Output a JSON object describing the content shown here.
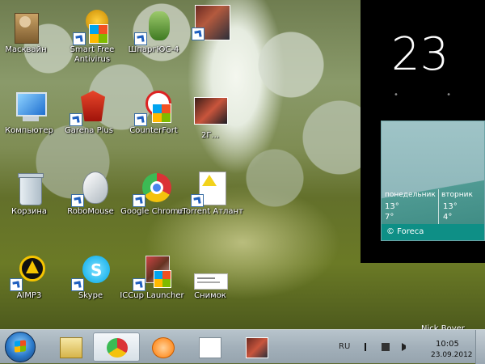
{
  "desktop": {
    "icons": [
      {
        "id": "mas",
        "label": "Масквайн"
      },
      {
        "id": "smart",
        "label": "Smart Free Antivirus"
      },
      {
        "id": "shpar",
        "label": "ШпаргЮС-4"
      },
      {
        "id": "top4",
        "label": ""
      },
      {
        "id": "comp",
        "label": "Компьютер"
      },
      {
        "id": "garena",
        "label": "Garena Plus"
      },
      {
        "id": "counter",
        "label": "CounterFort"
      },
      {
        "id": "mid4",
        "label": "2Г..."
      },
      {
        "id": "trash",
        "label": "Корзина"
      },
      {
        "id": "robo",
        "label": "RoboMouse"
      },
      {
        "id": "chrome",
        "label": "Google Chrome"
      },
      {
        "id": "utorrent",
        "label": "uTorrent Атлант"
      },
      {
        "id": "aimp",
        "label": "AIMP3"
      },
      {
        "id": "skype",
        "label": "Skype"
      },
      {
        "id": "iccup",
        "label": "ICCup Launcher"
      },
      {
        "id": "snimok",
        "label": "Снимок"
      }
    ],
    "username": "Nick Boyer"
  },
  "tiles": {
    "date_number": "23",
    "weather": {
      "days": [
        {
          "name": "понедельник",
          "high": "13°",
          "low": "7°"
        },
        {
          "name": "вторник",
          "high": "13°",
          "low": "4°"
        }
      ],
      "provider": "© Foreca"
    }
  },
  "taskbar": {
    "lang": "RU",
    "time": "10:05",
    "date": "23.09.2012",
    "buttons": [
      "Explorer",
      "Google Chrome",
      "Media Player",
      "Document",
      "Game"
    ]
  },
  "colors": {
    "tile_teal": "#0e8f86",
    "taskbar": "#a3b0ba"
  }
}
